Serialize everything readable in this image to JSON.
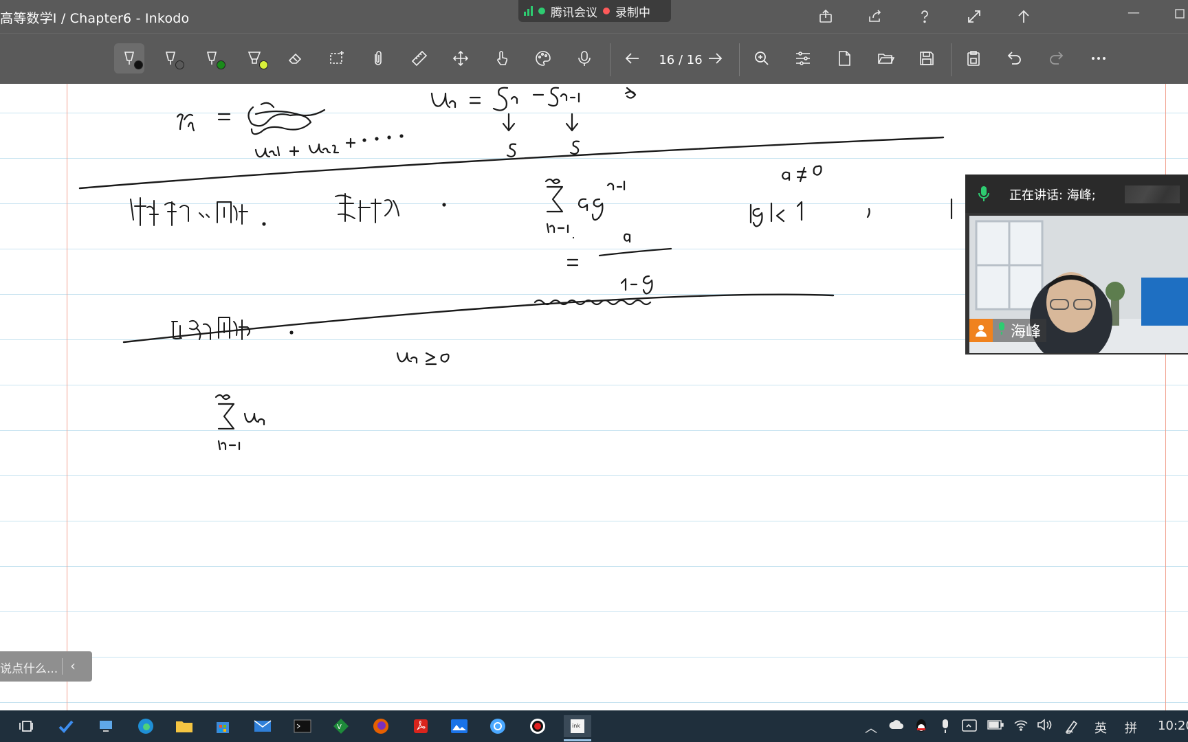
{
  "window": {
    "title": "高等数学I / Chapter6 - Inkodo"
  },
  "meeting": {
    "name": "腾讯会议",
    "recording": "录制中"
  },
  "toolbar": {
    "page_indicator": "16 / 16",
    "pen_colors": [
      "#111111",
      "#111111",
      "#1a8a1a",
      "#d8f03a"
    ]
  },
  "video_panel": {
    "speaking_text": "正在讲话: 海峰;",
    "participant_name": "海峰"
  },
  "chat": {
    "placeholder": "说点什么..."
  },
  "taskbar": {
    "ime_lang": "英",
    "ime_mode": "拼",
    "clock": "10:20"
  },
  "colors": {
    "chrome": "#5a5a5a",
    "taskbar": "#1f2f3c",
    "rule_line": "#c7e3f0",
    "margin_line": "#f1a08f",
    "accent_green": "#2ecc71"
  }
}
